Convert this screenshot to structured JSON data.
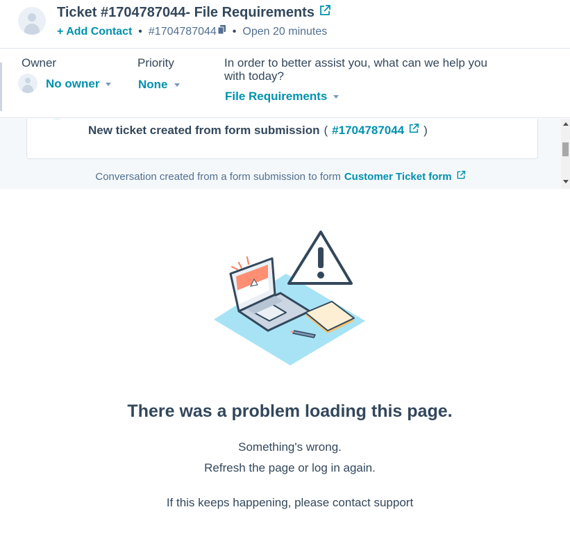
{
  "header": {
    "title": "Ticket #1704787044- File Requirements",
    "add_contact": "+ Add Contact",
    "ticket_id": "#1704787044",
    "separator": "•",
    "status": "Open 20 minutes"
  },
  "properties": {
    "owner": {
      "label": "Owner",
      "value": "No owner"
    },
    "priority": {
      "label": "Priority",
      "value": "None"
    },
    "question": {
      "label_line1": "In order to better assist you, what can we help you",
      "label_line2": "with today?",
      "value": "File Requirements"
    }
  },
  "timeline": {
    "card_text": "New ticket created from form submission",
    "open_paren": "(",
    "ticket_link": "#1704787044",
    "close_paren": ")",
    "note_prefix": "Conversation created from a form submission to form",
    "note_link": "Customer Ticket form"
  },
  "error": {
    "title": "There was a problem loading this page.",
    "line1": "Something's wrong.",
    "line2": "Refresh the page or log in again.",
    "line3": "If this keeps happening, please contact support"
  },
  "icons": {
    "external": "external-link-icon",
    "copy": "copy-icon",
    "avatar": "avatar-icon",
    "caret": "caret-down-icon"
  },
  "colors": {
    "link": "#0091ae",
    "text": "#33475b",
    "muted": "#516f90",
    "timeline_bg": "#f5f8fa"
  }
}
